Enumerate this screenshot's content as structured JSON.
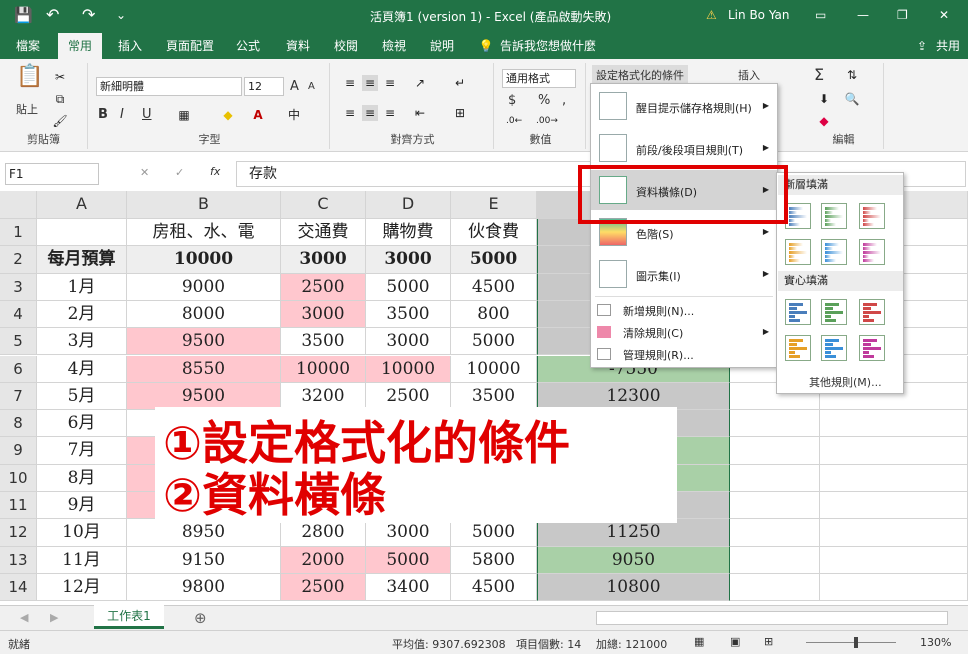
{
  "title": {
    "doc": "活頁簿1 (version 1)  -  Excel (產品啟動失敗)",
    "user": "Lin Bo Yan",
    "warn": "⚠",
    "quick": [
      "💾",
      "↶",
      "↷",
      "⌄"
    ],
    "controls": [
      "—",
      "❐",
      "▭",
      "✕"
    ]
  },
  "tabs": [
    {
      "label": "檔案"
    },
    {
      "label": "常用"
    },
    {
      "label": "插入"
    },
    {
      "label": "頁面配置"
    },
    {
      "label": "公式"
    },
    {
      "label": "資料"
    },
    {
      "label": "校閱"
    },
    {
      "label": "檢視"
    },
    {
      "label": "說明"
    },
    {
      "label": "告訴我您想做什麼"
    }
  ],
  "share": "共用",
  "ribbon": {
    "clipboard": "剪貼簿",
    "paste": "貼上",
    "font_group": "字型",
    "font_name": "新細明體",
    "font_size": "12",
    "bold": "B",
    "italic": "I",
    "underline": "U",
    "font_grow": "A",
    "font_shrink": "A",
    "align_group": "對齊方式",
    "number_group": "數值",
    "number_format": "通用格式",
    "currency": "$",
    "percent": "%",
    "comma": ",",
    "cond_format": "設定格式化的條件",
    "insert": "插入",
    "edit_group": "編輯",
    "sum": "Σ"
  },
  "formula_bar": {
    "cell_ref": "F1",
    "cancel": "✕",
    "enter": "✓",
    "fx": "fx",
    "content": "存款"
  },
  "columns": [
    "A",
    "B",
    "C",
    "D",
    "E"
  ],
  "rows": [
    {
      "n": "1",
      "cells": [
        "",
        "房租、水、電",
        "交通費",
        "購物費",
        "伙食費"
      ]
    },
    {
      "n": "2",
      "cells": [
        "每月預算",
        "10000",
        "3000",
        "3000",
        "5000"
      ]
    },
    {
      "n": "3",
      "cells": [
        "1月",
        "9000",
        "2500",
        "5000",
        "4500"
      ]
    },
    {
      "n": "4",
      "cells": [
        "2月",
        "8000",
        "3000",
        "3500",
        "800"
      ]
    },
    {
      "n": "5",
      "cells": [
        "3月",
        "9500",
        "3500",
        "3000",
        "5000"
      ]
    },
    {
      "n": "6",
      "cells": [
        "4月",
        "8550",
        "10000",
        "10000",
        "10000"
      ],
      "f": "-7550"
    },
    {
      "n": "7",
      "cells": [
        "5月",
        "9500",
        "3200",
        "2500",
        "3500"
      ],
      "f": "12300"
    },
    {
      "n": "8",
      "cells": [
        "6月",
        "",
        "",
        "",
        ""
      ]
    },
    {
      "n": "9",
      "cells": [
        "7月",
        "",
        "",
        "",
        ""
      ]
    },
    {
      "n": "10",
      "cells": [
        "8月",
        "",
        "",
        "",
        ""
      ]
    },
    {
      "n": "11",
      "cells": [
        "9月",
        "",
        "",
        "",
        ""
      ]
    },
    {
      "n": "12",
      "cells": [
        "10月",
        "8950",
        "2800",
        "3000",
        "5000"
      ],
      "f": "11250"
    },
    {
      "n": "13",
      "cells": [
        "11月",
        "9150",
        "2000",
        "5000",
        "5800"
      ],
      "f": "9050"
    },
    {
      "n": "14",
      "cells": [
        "12月",
        "9800",
        "2500",
        "3400",
        "4500"
      ],
      "f": "10800"
    }
  ],
  "menu": {
    "items": [
      {
        "label": "醒目提示儲存格規則(H)"
      },
      {
        "label": "前段/後段項目規則(T)"
      },
      {
        "label": "資料橫條(D)"
      },
      {
        "label": "色階(S)"
      },
      {
        "label": "圖示集(I)"
      }
    ],
    "small": [
      {
        "label": "新增規則(N)..."
      },
      {
        "label": "清除規則(C)"
      },
      {
        "label": "管理規則(R)..."
      }
    ]
  },
  "submenu": {
    "gradient": "漸層填滿",
    "solid": "實心填滿",
    "more": "其他規則(M)..."
  },
  "annotation": {
    "line1": "①設定格式化的條件",
    "line2": "②資料橫條"
  },
  "sheet_tab": "工作表1",
  "status": {
    "ready": "就緒",
    "average": "平均值: 9307.692308",
    "count": "項目個數: 14",
    "sum": "加總: 121000",
    "zoom": "130%"
  },
  "colors": {
    "accent": "#217346",
    "pink": "#ffc7ce",
    "green": "#a9d0a7",
    "gray": "#c8c8c8",
    "red": "#e00000"
  }
}
